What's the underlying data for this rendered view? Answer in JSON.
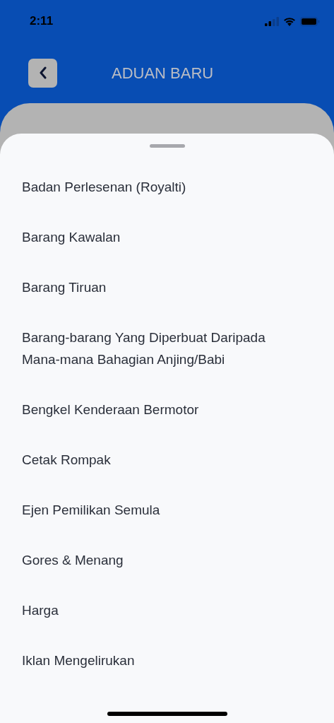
{
  "status_bar": {
    "time": "2:11"
  },
  "header": {
    "title": "ADUAN BARU"
  },
  "sheet": {
    "items": [
      {
        "label": "Badan Perlesenan (Royalti)"
      },
      {
        "label": "Barang Kawalan"
      },
      {
        "label": "Barang Tiruan"
      },
      {
        "label": "Barang-barang Yang Diperbuat Daripada Mana-mana Bahagian Anjing/Babi"
      },
      {
        "label": "Bengkel Kenderaan Bermotor"
      },
      {
        "label": "Cetak Rompak"
      },
      {
        "label": "Ejen Pemilikan Semula"
      },
      {
        "label": "Gores & Menang"
      },
      {
        "label": "Harga"
      },
      {
        "label": "Iklan Mengelirukan"
      }
    ]
  }
}
